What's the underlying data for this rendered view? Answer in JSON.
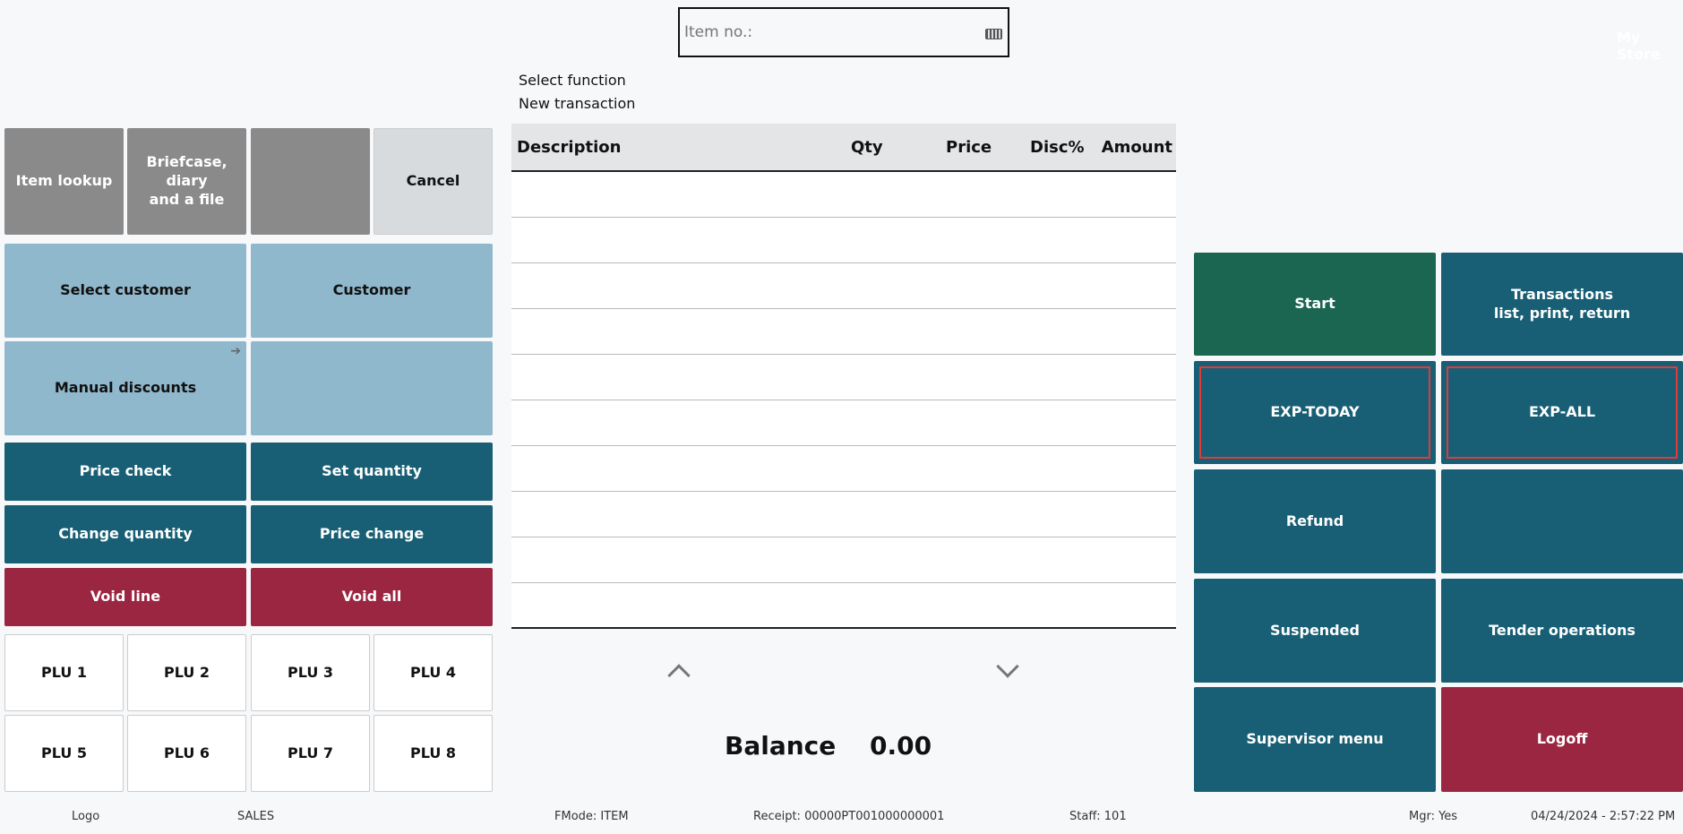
{
  "store_name": "My Store",
  "item_input": {
    "placeholder": "Item no.:",
    "icon": "keyboard-icon"
  },
  "info": {
    "line1": "Select function",
    "line2": "New transaction"
  },
  "table": {
    "columns": [
      "Description",
      "Qty",
      "Price",
      "Disc%",
      "Amount"
    ],
    "rows": 10
  },
  "balance": {
    "label": "Balance",
    "value": "0.00"
  },
  "left_buttons": {
    "item_lookup": "Item lookup",
    "briefcase": "Briefcase, diary\nand a file",
    "blank1": "",
    "cancel": "Cancel",
    "select_customer": "Select customer",
    "customer": "Customer",
    "manual_discounts": "Manual discounts",
    "blank2": "",
    "price_check": "Price check",
    "set_quantity": "Set quantity",
    "change_quantity": "Change quantity",
    "price_change": "Price change",
    "void_line": "Void line",
    "void_all": "Void all"
  },
  "plu": [
    "PLU 1",
    "PLU 2",
    "PLU 3",
    "PLU 4",
    "PLU 5",
    "PLU 6",
    "PLU 7",
    "PLU 8"
  ],
  "right_buttons": {
    "start": "Start",
    "transactions": "Transactions\nlist, print, return",
    "exp_today": "EXP-TODAY",
    "exp_all": "EXP-ALL",
    "refund": "Refund",
    "blank": "",
    "suspended": "Suspended",
    "tender": "Tender operations",
    "supervisor": "Supervisor menu",
    "logoff": "Logoff"
  },
  "status": {
    "logo": "Logo",
    "mode": "SALES",
    "fmode": "FMode: ITEM",
    "receipt": "Receipt: 00000PT001000000001",
    "staff": "Staff: 101",
    "mgr": "Mgr: Yes",
    "datetime": "04/24/2024 - 2:57:22 PM"
  }
}
